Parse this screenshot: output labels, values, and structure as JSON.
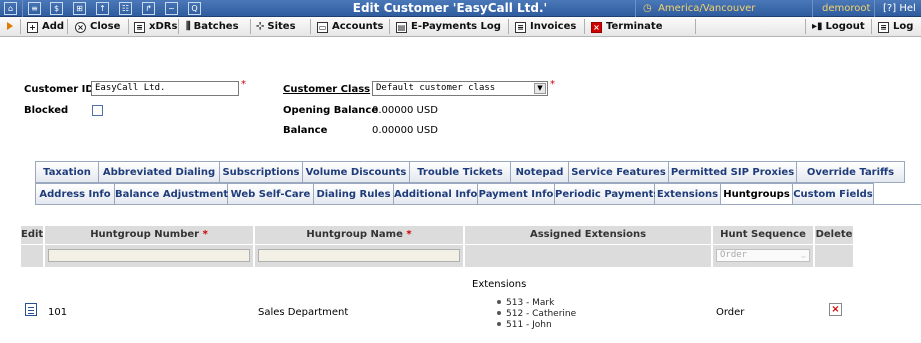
{
  "titlebar": {
    "title": "Edit Customer 'EasyCall Ltd.'",
    "timezone": "America/Vancouver",
    "user": "demoroot",
    "help": "Hel"
  },
  "toolbar": {
    "add": "Add",
    "close": "Close",
    "xdrs": "xDRs",
    "batches": "Batches",
    "sites": "Sites",
    "accounts": "Accounts",
    "epayments": "E-Payments Log",
    "invoices": "Invoices",
    "terminate": "Terminate",
    "logout": "Logout",
    "log": "Log"
  },
  "form": {
    "customer_id_label": "Customer ID",
    "customer_id_value": "EasyCall Ltd.",
    "customer_class_label": "Customer Class",
    "customer_class_value": "Default customer class",
    "blocked_label": "Blocked",
    "opening_balance_label": "Opening Balance",
    "opening_balance_value": "0.00000 USD",
    "balance_label": "Balance",
    "balance_value": "0.00000 USD",
    "req": "*"
  },
  "tabs_row1": [
    "Taxation",
    "Abbreviated Dialing",
    "Subscriptions",
    "Volume Discounts",
    "Trouble Tickets",
    "Notepad",
    "Service Features",
    "Permitted SIP Proxies",
    "Override Tariffs"
  ],
  "tabs_row2": [
    "Address Info",
    "Balance Adjustments",
    "Web Self-Care",
    "Dialing Rules",
    "Additional Info",
    "Payment Info",
    "Periodic Payments",
    "Extensions",
    "Huntgroups",
    "Custom Fields"
  ],
  "table": {
    "headers": {
      "edit": "Edit",
      "number": "Huntgroup Number",
      "name": "Huntgroup Name",
      "assigned": "Assigned Extensions",
      "sequence": "Hunt Sequence",
      "delete": "Delete",
      "req": "*"
    },
    "filter_sequence": "Order",
    "row": {
      "number": "101",
      "name": "Sales Department",
      "extensions_title": "Extensions",
      "extensions": [
        "513 - Mark",
        "512 - Catherine",
        "511 - John"
      ],
      "sequence": "Order"
    }
  },
  "colors": {
    "titlebar": "#2f5c9e",
    "tab_text": "#1f3c7a",
    "required": "#d00000"
  }
}
